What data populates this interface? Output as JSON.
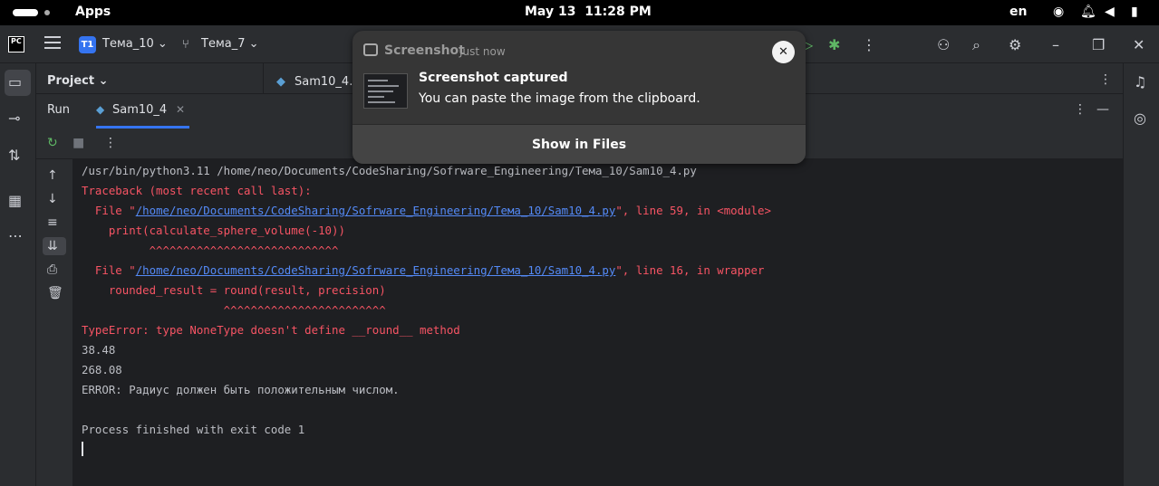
{
  "topbar": {
    "apps_label": "Apps",
    "date": "May 13",
    "time": "11:28 PM",
    "keyboard_layout": "en",
    "tray_icons": [
      "wifi-icon",
      "notification-icon",
      "volume-icon",
      "battery-icon"
    ]
  },
  "ide": {
    "logo_text": "PC",
    "project_badge": "T1",
    "project_name": "Тема_10",
    "branch_name": "Тема_7",
    "project_panel_title": "Project",
    "editor_tab": "Sam10_4.py",
    "run_label": "Run",
    "run_tab": "Sam10_4"
  },
  "console": {
    "lines": [
      {
        "text": "/usr/bin/python3.11 /home/neo/Documents/CodeSharing/Sofrware_Engineering/Тема_10/Sam10_4.py",
        "style": "white"
      },
      {
        "text": "Traceback (most recent call last):",
        "style": "red"
      },
      {
        "pre": "  File \"",
        "link": "/home/neo/Documents/CodeSharing/Sofrware_Engineering/Тема_10/Sam10_4.py",
        "post": "\", line 59, in <module>",
        "style": "red"
      },
      {
        "text": "    print(calculate_sphere_volume(-10))",
        "style": "red"
      },
      {
        "text": "          ^^^^^^^^^^^^^^^^^^^^^^^^^^^^",
        "style": "red"
      },
      {
        "pre": "  File \"",
        "link": "/home/neo/Documents/CodeSharing/Sofrware_Engineering/Тема_10/Sam10_4.py",
        "post": "\", line 16, in wrapper",
        "style": "red"
      },
      {
        "text": "    rounded_result = round(result, precision)",
        "style": "red"
      },
      {
        "text": "                     ^^^^^^^^^^^^^^^^^^^^^^^^",
        "style": "red"
      },
      {
        "text": "TypeError: type NoneType doesn't define __round__ method",
        "style": "red"
      },
      {
        "text": "38.48",
        "style": "white"
      },
      {
        "text": "268.08",
        "style": "white"
      },
      {
        "text": "ERROR: Радиус должен быть положительным числом.",
        "style": "white"
      },
      {
        "text": "",
        "style": "white"
      },
      {
        "text": "Process finished with exit code 1",
        "style": "white"
      }
    ]
  },
  "notification": {
    "app_name": "Screenshot",
    "time": "Just now",
    "title": "Screenshot captured",
    "body": "You can paste the image from the clipboard.",
    "action": "Show in Files",
    "close_glyph": "✕"
  },
  "colors": {
    "accent": "#3574f0",
    "error_text": "#f75464",
    "link": "#548af7"
  }
}
